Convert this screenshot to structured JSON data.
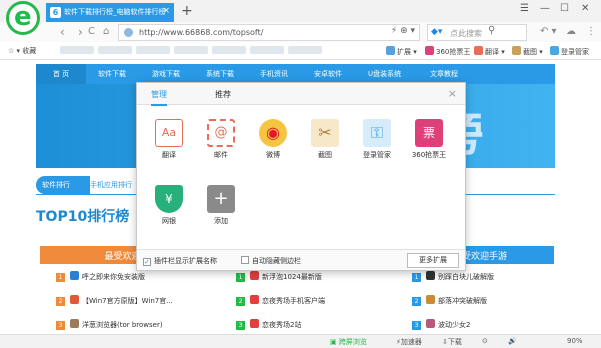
{
  "browser": {
    "tab_title": "软件下载排行榜_电脑软件排行榜",
    "tab_close": "×",
    "new_tab": "+",
    "window_controls": [
      "☰",
      "—",
      "☐",
      "✕"
    ],
    "nav": {
      "back": "‹",
      "forward": "›",
      "reload": "C",
      "home": "⌂"
    },
    "address": "http://www.66868.com/topsoft/",
    "address_right": "⚡ ⊕ ▾",
    "search_placeholder": "点此搜索",
    "search_icon": "search-icon",
    "toolbar_right": [
      "↶ ▾",
      "☁",
      "⋮"
    ],
    "bookmarks": {
      "favorites": "收藏",
      "items": [
        "扩展",
        "360抢票王",
        "翻译",
        "截图",
        "登录管家"
      ],
      "extra": "»"
    }
  },
  "page": {
    "nav_items": [
      "首 页",
      "软件下载",
      "游戏下载",
      "系统下载",
      "手机资讯",
      "安卓软件",
      "U盘装系统",
      "文章教程"
    ],
    "banner_word": "旁",
    "rank_tabs": [
      "软件排行",
      "手机应用排行"
    ],
    "top10_title": "TOP10排行榜",
    "columns": [
      {
        "title": "最受欢迎软",
        "color": "#f08a3b"
      },
      {
        "title": "",
        "color": "#25b84b"
      },
      {
        "title": "最受欢迎手游",
        "color": "#2a9ae6"
      }
    ],
    "list_left": [
      {
        "n": "1",
        "text": "呼之即来你免安装版"
      },
      {
        "n": "2",
        "text": "【Win7官方原版】Win7官..."
      },
      {
        "n": "3",
        "text": "洋葱浏览器(tor browser)"
      }
    ],
    "list_mid": [
      {
        "n": "1",
        "text": "新浮泡1024最新版"
      },
      {
        "n": "2",
        "text": "恋夜秀场手机客户端"
      },
      {
        "n": "3",
        "text": "恋夜秀场2站"
      }
    ],
    "list_right": [
      {
        "n": "1",
        "text": "别踩白块儿破解版"
      },
      {
        "n": "2",
        "text": "部落冲突破解版"
      },
      {
        "n": "3",
        "text": "波动少女2"
      }
    ]
  },
  "dialog": {
    "tabs": [
      "管理",
      "推荐"
    ],
    "close": "×",
    "extensions": [
      {
        "label": "翻译",
        "icon": "translate-icon",
        "glyph": "Aa",
        "color": "#e86c56"
      },
      {
        "label": "邮件",
        "icon": "mail-icon",
        "glyph": "@",
        "color": "#e86c56"
      },
      {
        "label": "微博",
        "icon": "weibo-icon",
        "glyph": "◉",
        "color": "#e6162d"
      },
      {
        "label": "截图",
        "icon": "scissors-icon",
        "glyph": "✂",
        "color": "#c9a15c"
      },
      {
        "label": "登录管家",
        "icon": "key-icon",
        "glyph": "⚿",
        "color": "#4aa8e0"
      },
      {
        "label": "360抢票王",
        "icon": "ticket-icon",
        "glyph": "票",
        "color": "#e0407a"
      },
      {
        "label": "网银",
        "icon": "bank-shield-icon",
        "glyph": "¥",
        "color": "#28b07a"
      },
      {
        "label": "添加",
        "icon": "add-icon",
        "glyph": "+",
        "color": "#8a8a8a"
      }
    ],
    "footer": {
      "show_names": "插件栏显示扩展名称",
      "auto_hide": "自动隐藏侧边栏",
      "more_button": "更多扩展"
    }
  },
  "statusbar": {
    "items": [
      "跨屏浏览",
      "加速器",
      "下载",
      "⊙",
      "🔊",
      "90%"
    ]
  },
  "colors": {
    "accent": "#2a9ae6",
    "brand_green": "#25b84b"
  }
}
